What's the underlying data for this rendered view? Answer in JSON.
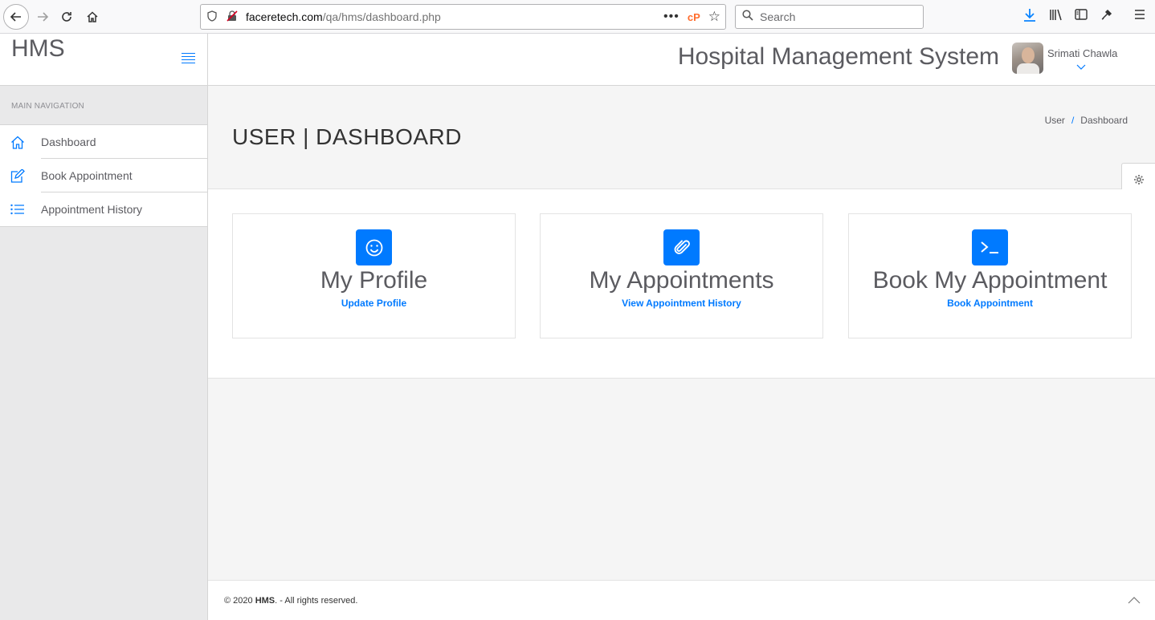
{
  "browser": {
    "url_host": "faceretech.com",
    "url_path": "/qa/hms/dashboard.php",
    "search_placeholder": "Search",
    "cp_label": "cP"
  },
  "sidebar": {
    "brand": "HMS",
    "section_label": "MAIN NAVIGATION",
    "items": [
      {
        "label": "Dashboard",
        "icon": "home-icon"
      },
      {
        "label": "Book Appointment",
        "icon": "edit-icon"
      },
      {
        "label": "Appointment History",
        "icon": "list-icon"
      }
    ]
  },
  "header": {
    "title": "Hospital Management System",
    "user_name": "Srimati Chawla"
  },
  "page": {
    "title": "USER | DASHBOARD",
    "breadcrumb": [
      "User",
      "Dashboard"
    ]
  },
  "cards": [
    {
      "title": "My Profile",
      "link": "Update Profile",
      "icon": "smile-icon"
    },
    {
      "title": "My Appointments",
      "link": "View Appointment History",
      "icon": "paperclip-icon"
    },
    {
      "title": "Book My Appointment",
      "link": "Book Appointment",
      "icon": "terminal-icon"
    }
  ],
  "footer": {
    "prefix": "© 2020 ",
    "brand": "HMS",
    "suffix": ". - All rights reserved."
  },
  "colors": {
    "accent": "#007aff",
    "text": "#5b5b60"
  }
}
